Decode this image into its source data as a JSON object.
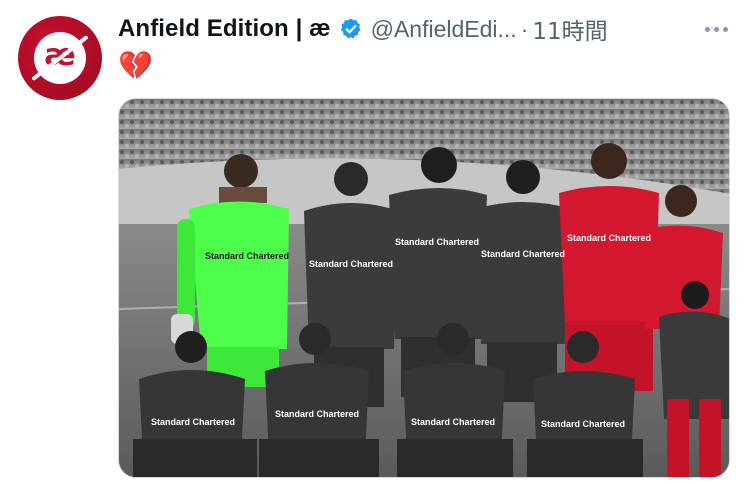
{
  "tweet": {
    "display_name": "Anfield Edition | æ",
    "handle": "@AnfieldEdi...",
    "dot": "·",
    "time": "11時間",
    "text": "💔",
    "avatar_letter": "æ",
    "more_icon": "more-horizontal-icon",
    "verified_icon": "verified-badge-icon"
  },
  "photo": {
    "sponsor_text": "Standard Chartered"
  },
  "colors": {
    "brand_red": "#c8102e",
    "verified_blue": "#1d9bf0",
    "keeper_green": "#4dff4a",
    "kit_red": "#d3172e"
  }
}
